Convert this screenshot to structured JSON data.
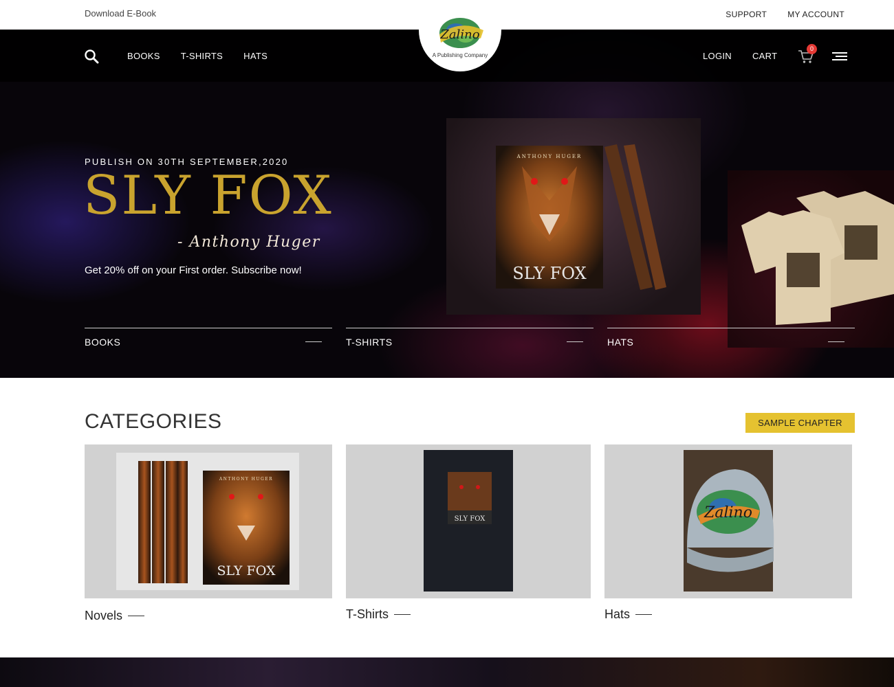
{
  "topbar": {
    "ebook_label": "Download E-Book",
    "support_label": "SUPPORT",
    "account_label": "MY ACCOUNT"
  },
  "nav": {
    "links": [
      "BOOKS",
      "T-SHIRTS",
      "HATS"
    ],
    "login_label": "LOGIN",
    "cart_label": "CART",
    "cart_count": "0"
  },
  "logo": {
    "text": "Zalino",
    "tagline": "A Publishing Company"
  },
  "hero": {
    "publish_note": "PUBLISH ON 30TH SEPTEMBER,2020",
    "title": "SLY FOX",
    "author": "- Anthony Huger",
    "offer": "Get 20% off on your First order. Subscribe now!",
    "book_author": "ANTHONY HUGER",
    "book_title": "SLY FOX",
    "tabs": [
      "BOOKS",
      "T-SHIRTS",
      "HATS"
    ]
  },
  "categories": {
    "heading": "CATEGORIES",
    "sample_label": "SAMPLE CHAPTER",
    "items": [
      {
        "label": "Novels",
        "cover_author": "ANTHONY HUGER",
        "cover_title": "SLY FOX"
      },
      {
        "label": "T-Shirts",
        "print_title": "SLY FOX"
      },
      {
        "label": "Hats",
        "patch_text": "Zalino"
      }
    ]
  },
  "colors": {
    "accent_gold": "#c9a32e",
    "button_yellow": "#e5c230",
    "badge_red": "#e53935"
  }
}
